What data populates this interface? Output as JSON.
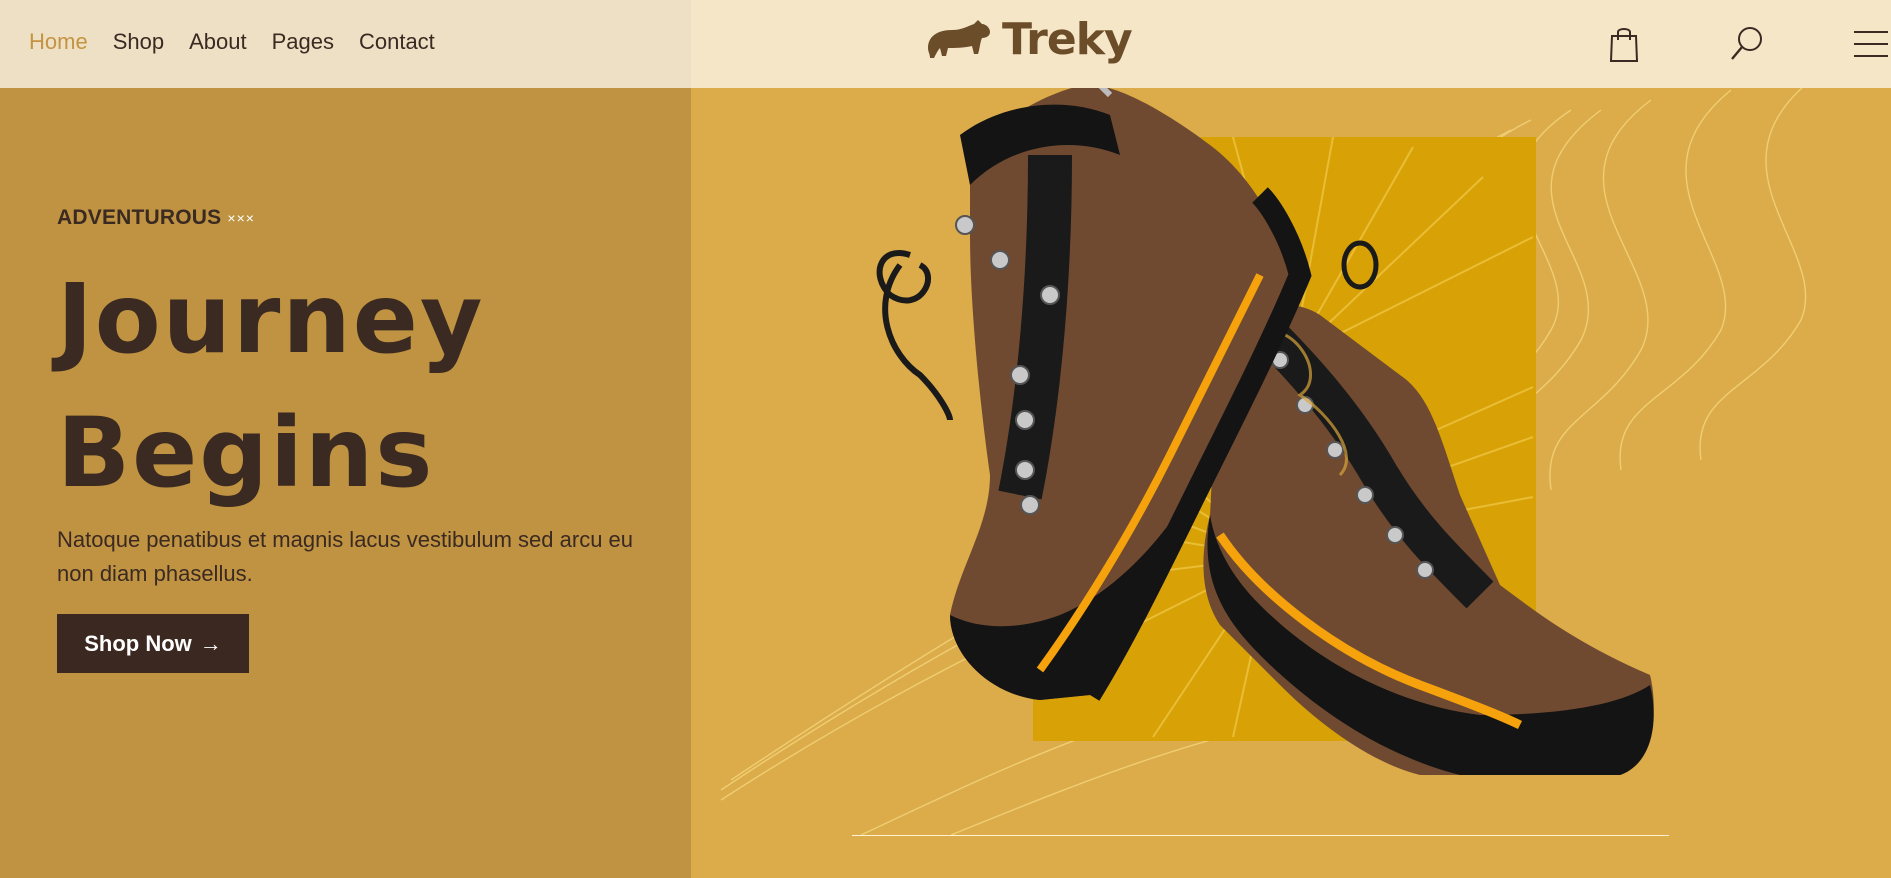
{
  "nav": {
    "items": [
      {
        "label": "Home",
        "active": true
      },
      {
        "label": "Shop",
        "active": false
      },
      {
        "label": "About",
        "active": false
      },
      {
        "label": "Pages",
        "active": false
      },
      {
        "label": "Contact",
        "active": false
      }
    ]
  },
  "brand": {
    "name": "Treky",
    "logo_icon": "bear-icon"
  },
  "header_icons": [
    "shopping-bag-icon",
    "search-icon",
    "menu-icon"
  ],
  "hero": {
    "eyebrow": "ADVENTUROUS",
    "eyebrow_mark": "×××",
    "headline_line1": "Journey",
    "headline_line2": "Begins",
    "description": "Natoque penatibus et magnis lacus vestibulum sed arcu eu non diam phasellus.",
    "cta_label": "Shop Now",
    "cta_arrow": "→"
  },
  "colors": {
    "accent": "#c59442",
    "dark": "#3b2820",
    "left_panel": "#bf9341",
    "right_panel": "#dcab4a",
    "palm_square": "#d8a207",
    "boot_sole_accent": "#f5a20c"
  }
}
